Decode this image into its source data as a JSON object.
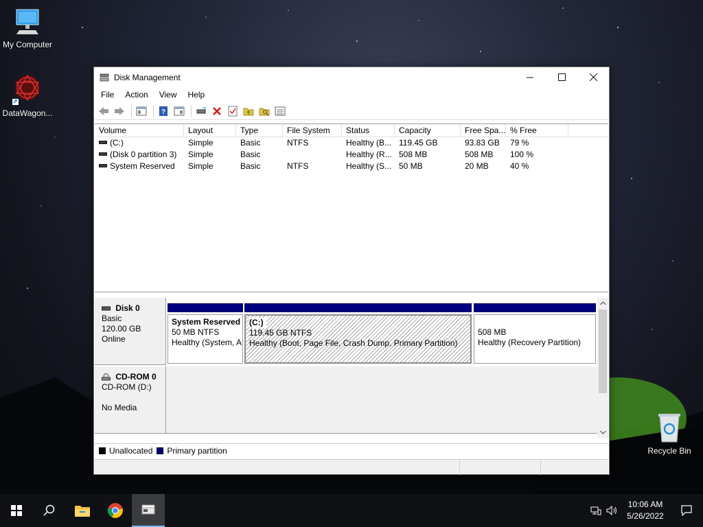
{
  "desktop": {
    "icons": [
      {
        "label": "My Computer"
      },
      {
        "label": "DataWagon..."
      },
      {
        "label": "Recycle Bin"
      }
    ]
  },
  "window": {
    "title": "Disk Management",
    "menu": [
      "File",
      "Action",
      "View",
      "Help"
    ]
  },
  "list": {
    "headers": [
      "Volume",
      "Layout",
      "Type",
      "File System",
      "Status",
      "Capacity",
      "Free Spa...",
      "% Free"
    ],
    "rows": [
      {
        "volume": "(C:)",
        "layout": "Simple",
        "type": "Basic",
        "fs": "NTFS",
        "status": "Healthy (B...",
        "capacity": "119.45 GB",
        "free": "93.83 GB",
        "pct": "79 %"
      },
      {
        "volume": "(Disk 0 partition 3)",
        "layout": "Simple",
        "type": "Basic",
        "fs": "",
        "status": "Healthy (R...",
        "capacity": "508 MB",
        "free": "508 MB",
        "pct": "100 %"
      },
      {
        "volume": "System Reserved",
        "layout": "Simple",
        "type": "Basic",
        "fs": "NTFS",
        "status": "Healthy (S...",
        "capacity": "50 MB",
        "free": "20 MB",
        "pct": "40 %"
      }
    ]
  },
  "disks": {
    "disk0": {
      "name": "Disk 0",
      "type": "Basic",
      "size": "120.00 GB",
      "state": "Online",
      "partitions": [
        {
          "name": "System Reserved",
          "size": "50 MB NTFS",
          "status": "Healthy (System, A"
        },
        {
          "name": "(C:)",
          "size": "119.45 GB NTFS",
          "status": "Healthy (Boot, Page File, Crash Dump, Primary Partition)"
        },
        {
          "name": "",
          "size": "508 MB",
          "status": "Healthy (Recovery Partition)"
        }
      ]
    },
    "cdrom0": {
      "name": "CD-ROM 0",
      "drive": "CD-ROM (D:)",
      "media": "No Media"
    }
  },
  "legend": {
    "unallocated": "Unallocated",
    "primary": "Primary partition"
  },
  "colors": {
    "primary_partition": "#000080",
    "unallocated": "#000000",
    "taskbar": "#101114"
  },
  "taskbar": {
    "time": "10:06 AM",
    "date": "5/26/2022"
  }
}
